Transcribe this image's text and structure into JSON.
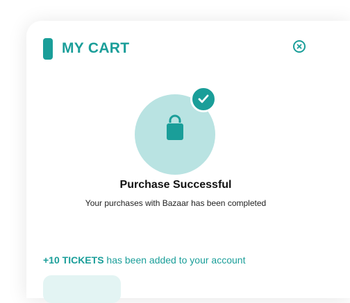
{
  "header": {
    "title": "MY CART",
    "close_icon": "close-circle-icon"
  },
  "status": {
    "illustration_icon": "shopping-bag-icon",
    "badge_icon": "check-icon",
    "title": "Purchase Successful",
    "subtitle": "Your purchases with Bazaar has been completed"
  },
  "rewards": {
    "highlight": "+10 TICKETS",
    "message": " has been added to your account"
  },
  "colors": {
    "accent": "#1a9e99",
    "accent_light": "#b9e3e2",
    "button_bg": "#e3f4f3"
  }
}
